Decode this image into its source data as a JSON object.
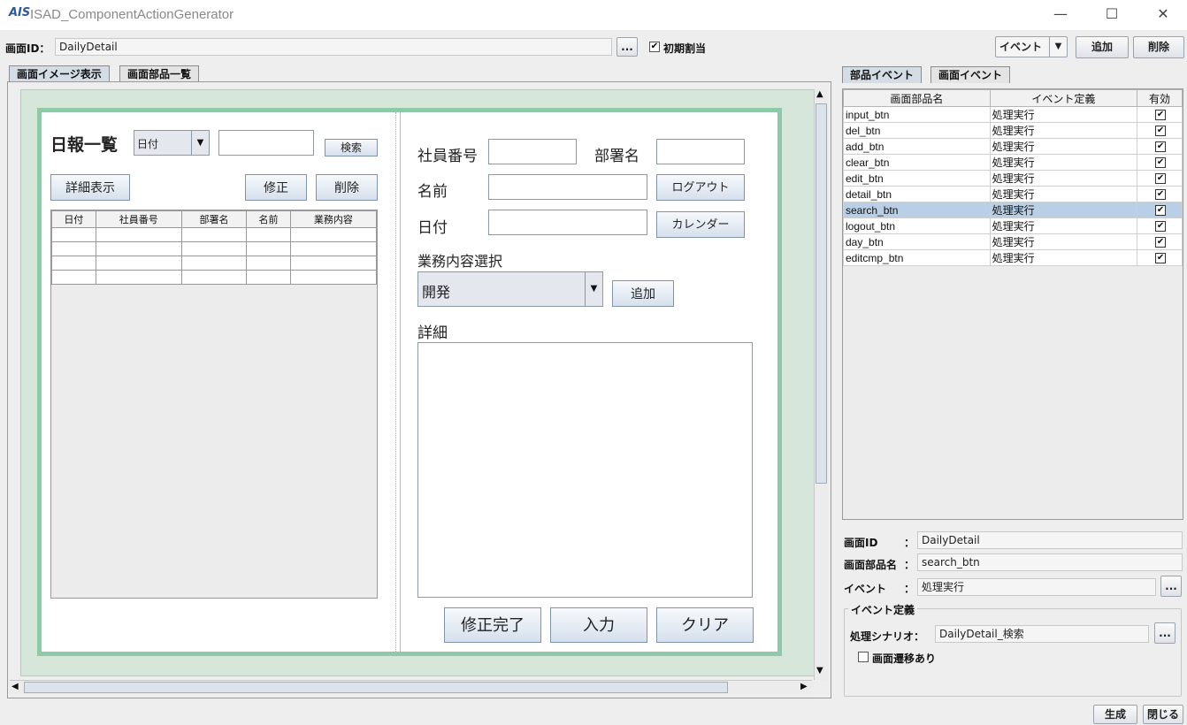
{
  "window": {
    "logo": "AIS",
    "title": "ISAD_ComponentActionGenerator",
    "minimize": "—",
    "maximize": "☐",
    "close": "✕"
  },
  "toolbar": {
    "screen_id_label": "画面ID：",
    "screen_id_value": "DailyDetail",
    "browse_label": "...",
    "initial_assign_checked": true,
    "initial_assign_label": "初期割当",
    "event_select": "イベント",
    "add_label": "追加",
    "delete_label": "削除"
  },
  "left_tabs": [
    "画面イメージ表示",
    "画面部品一覧"
  ],
  "design": {
    "list_title": "日報一覧",
    "filter_select": "日付",
    "search_btn": "検索",
    "detail_btn": "詳細表示",
    "edit_btn": "修正",
    "delete_btn": "削除",
    "table_headers": [
      "日付",
      "社員番号",
      "部署名",
      "名前",
      "業務内容"
    ],
    "employee_no_label": "社員番号",
    "dept_label": "部署名",
    "name_label": "名前",
    "logout_btn": "ログアウト",
    "date_label": "日付",
    "calendar_btn": "カレンダー",
    "work_select_label": "業務内容選択",
    "work_select_value": "開発",
    "add_btn": "追加",
    "detail_label": "詳細",
    "edit_done_btn": "修正完了",
    "input_btn": "入力",
    "clear_btn": "クリア"
  },
  "right_tabs": [
    "部品イベント",
    "画面イベント"
  ],
  "events_table": {
    "headers": [
      "画面部品名",
      "イベント定義",
      "有効"
    ],
    "rows": [
      {
        "name": "input_btn",
        "event": "処理実行",
        "enabled": true
      },
      {
        "name": "del_btn",
        "event": "処理実行",
        "enabled": true
      },
      {
        "name": "add_btn",
        "event": "処理実行",
        "enabled": true
      },
      {
        "name": "clear_btn",
        "event": "処理実行",
        "enabled": true
      },
      {
        "name": "edit_btn",
        "event": "処理実行",
        "enabled": true
      },
      {
        "name": "detail_btn",
        "event": "処理実行",
        "enabled": true
      },
      {
        "name": "search_btn",
        "event": "処理実行",
        "enabled": true,
        "selected": true
      },
      {
        "name": "logout_btn",
        "event": "処理実行",
        "enabled": true
      },
      {
        "name": "day_btn",
        "event": "処理実行",
        "enabled": true
      },
      {
        "name": "editcmp_btn",
        "event": "処理実行",
        "enabled": true
      }
    ]
  },
  "detail_form": {
    "screen_id_label": "画面ID",
    "screen_id_value": "DailyDetail",
    "part_name_label": "画面部品名",
    "part_name_value": "search_btn",
    "event_label": "イベント",
    "event_value": "処理実行",
    "colon": "：",
    "group_label": "イベント定義",
    "scenario_label": "処理シナリオ：",
    "scenario_value": "DailyDetail_検索",
    "transition_label": "画面遷移あり",
    "transition_checked": false
  },
  "footer": {
    "generate_btn": "生成",
    "close_btn": "閉じる"
  }
}
